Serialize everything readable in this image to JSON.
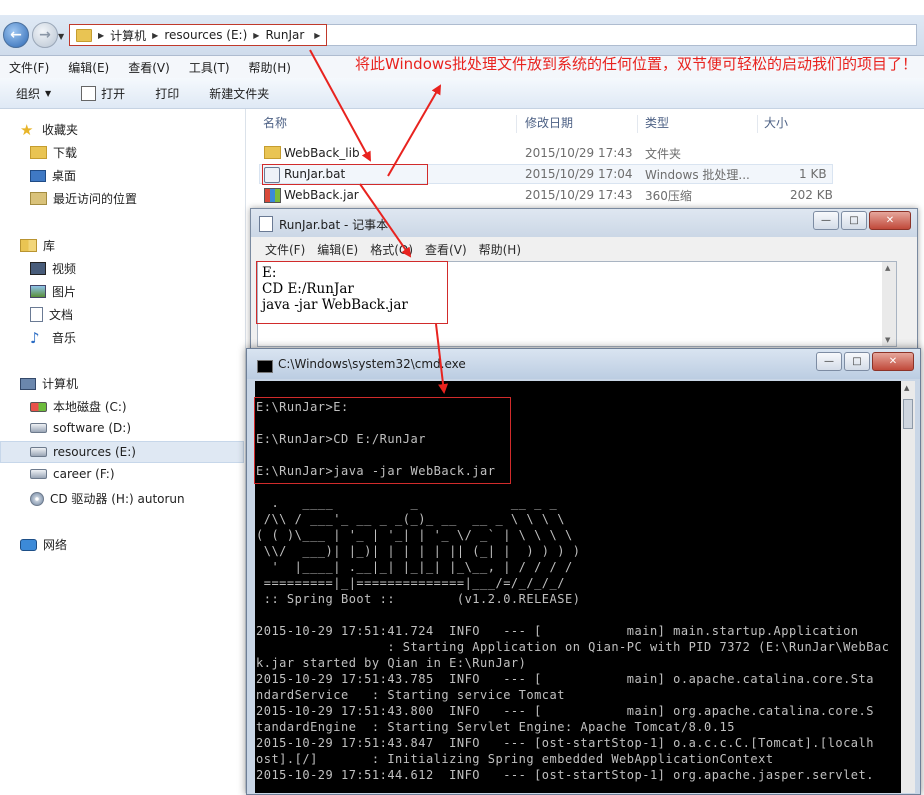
{
  "explorer": {
    "breadcrumb": [
      "计算机",
      "resources (E:)",
      "RunJar"
    ],
    "menu": [
      "文件(F)",
      "编辑(E)",
      "查看(V)",
      "工具(T)",
      "帮助(H)"
    ],
    "toolbar": {
      "organize": "组织",
      "open": "打开",
      "print": "打印",
      "new_folder": "新建文件夹"
    },
    "nav": {
      "favorites": "收藏夹",
      "fav_items": [
        "下载",
        "桌面",
        "最近访问的位置"
      ],
      "libraries": "库",
      "lib_items": [
        "视频",
        "图片",
        "文档",
        "音乐"
      ],
      "computer": "计算机",
      "drives": [
        "本地磁盘 (C:)",
        "software (D:)",
        "resources (E:)",
        "career (F:)",
        "CD 驱动器 (H:) autorun"
      ],
      "network": "网络"
    },
    "columns": {
      "name": "名称",
      "date": "修改日期",
      "type": "类型",
      "size": "大小"
    },
    "files": [
      {
        "name": "WebBack_lib",
        "date": "2015/10/29 17:43",
        "type": "文件夹",
        "size": ""
      },
      {
        "name": "RunJar.bat",
        "date": "2015/10/29 17:04",
        "type": "Windows 批处理...",
        "size": "1 KB"
      },
      {
        "name": "WebBack.jar",
        "date": "2015/10/29 17:43",
        "type": "360压缩",
        "size": "202 KB"
      }
    ]
  },
  "annotation": "将此Windows批处理文件放到系统的任何位置，双节便可轻松的启动我们的项目了！",
  "notepad": {
    "title": "RunJar.bat - 记事本",
    "menu": [
      "文件(F)",
      "编辑(E)",
      "格式(O)",
      "查看(V)",
      "帮助(H)"
    ],
    "content": "E:\nCD E:/RunJar\njava -jar WebBack.jar"
  },
  "cmd": {
    "title": "C:\\Windows\\system32\\cmd.exe",
    "lines": [
      "E:\\RunJar>E:",
      "",
      "E:\\RunJar>CD E:/RunJar",
      "",
      "E:\\RunJar>java -jar WebBack.jar",
      "",
      "  .   ____          _            __ _ _",
      " /\\\\ / ___'_ __ _ _(_)_ __  __ _ \\ \\ \\ \\",
      "( ( )\\___ | '_ | '_| | '_ \\/ _` | \\ \\ \\ \\",
      " \\\\/  ___)| |_)| | | | | || (_| |  ) ) ) )",
      "  '  |____| .__|_| |_|_| |_\\__, | / / / /",
      " =========|_|==============|___/=/_/_/_/",
      " :: Spring Boot ::        (v1.2.0.RELEASE)",
      "",
      "2015-10-29 17:51:41.724  INFO   --- [           main] main.startup.Application",
      "                 : Starting Application on Qian-PC with PID 7372 (E:\\RunJar\\WebBac",
      "k.jar started by Qian in E:\\RunJar)",
      "2015-10-29 17:51:43.785  INFO   --- [           main] o.apache.catalina.core.Sta",
      "ndardService   : Starting service Tomcat",
      "2015-10-29 17:51:43.800  INFO   --- [           main] org.apache.catalina.core.S",
      "tandardEngine  : Starting Servlet Engine: Apache Tomcat/8.0.15",
      "2015-10-29 17:51:43.847  INFO   --- [ost-startStop-1] o.a.c.c.C.[Tomcat].[localh",
      "ost].[/]       : Initializing Spring embedded WebApplicationContext",
      "2015-10-29 17:51:44.612  INFO   --- [ost-startStop-1] org.apache.jasper.servlet."
    ]
  },
  "colors": {
    "annotation_red": "#e8231f",
    "highlight_red": "#d12b2b",
    "cmd_bg": "#000000",
    "cmd_text": "#c0c0c0"
  }
}
